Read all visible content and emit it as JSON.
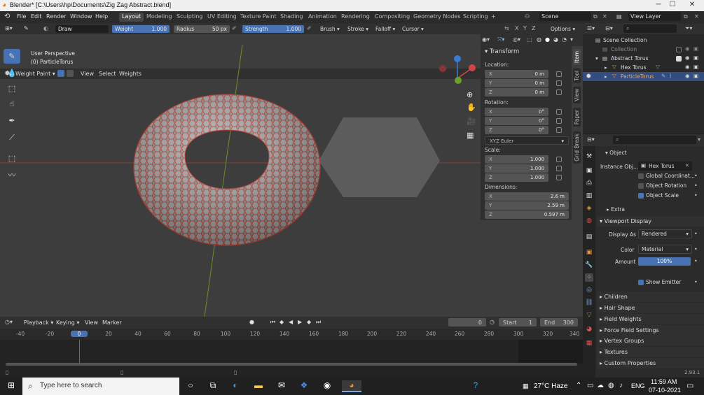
{
  "window": {
    "title": "Blender* [C:\\Users\\hp\\Documents\\Zig Zag Abstract.blend]",
    "minimize": "─",
    "maximize": "☐",
    "close": "✕"
  },
  "menu": [
    "File",
    "Edit",
    "Render",
    "Window",
    "Help"
  ],
  "workspaces": [
    "Layout",
    "Modeling",
    "Sculpting",
    "UV Editing",
    "Texture Paint",
    "Shading",
    "Animation",
    "Rendering",
    "Compositing",
    "Geometry Nodes",
    "Scripting"
  ],
  "active_workspace": "Layout",
  "add_workspace": "+",
  "scene": "Scene",
  "view_layer": "View Layer",
  "toolheader": {
    "brush_name": "Draw",
    "weight_label": "Weight",
    "weight_value": "1.000",
    "radius_label": "Radius",
    "radius_value": "50 px",
    "strength_label": "Strength",
    "strength_value": "1.000",
    "menus": [
      "Brush",
      "Stroke",
      "Falloff",
      "Cursor"
    ],
    "options": "Options",
    "xyz": [
      "X",
      "Y",
      "Z"
    ]
  },
  "viewport_header": {
    "mode": "Weight Paint",
    "menus": [
      "View",
      "Select",
      "Weights"
    ]
  },
  "viewport": {
    "perspective": "User Perspective",
    "object": "(0) ParticleTorus"
  },
  "npanel": {
    "section": "Transform",
    "location_label": "Location:",
    "location": [
      [
        "X",
        "0 m"
      ],
      [
        "Y",
        "0 m"
      ],
      [
        "Z",
        "0 m"
      ]
    ],
    "rotation_label": "Rotation:",
    "rotation": [
      [
        "X",
        "0°"
      ],
      [
        "Y",
        "0°"
      ],
      [
        "Z",
        "0°"
      ]
    ],
    "rotation_mode": "XYZ Euler",
    "scale_label": "Scale:",
    "scale": [
      [
        "X",
        "1.000"
      ],
      [
        "Y",
        "1.000"
      ],
      [
        "Z",
        "1.000"
      ]
    ],
    "dimensions_label": "Dimensions:",
    "dimensions": [
      [
        "X",
        "2.6 m"
      ],
      [
        "Y",
        "2.59 m"
      ],
      [
        "Z",
        "0.597 m"
      ]
    ],
    "tabs": [
      "Item",
      "Tool",
      "View",
      "Paper",
      "Grid Break"
    ]
  },
  "timeline": {
    "menus": [
      "Playback",
      "Keying",
      "View",
      "Marker"
    ],
    "current_frame": "0",
    "start_label": "Start",
    "start": "1",
    "end_label": "End",
    "end": "300",
    "ruler": [
      "-40",
      "-20",
      "0",
      "20",
      "40",
      "60",
      "80",
      "100",
      "120",
      "140",
      "160",
      "180",
      "200",
      "220",
      "240",
      "260",
      "280",
      "300",
      "320",
      "340"
    ]
  },
  "outliner": {
    "rows": [
      "Scene Collection",
      "Collection",
      "Abstract Torus",
      "Hex Torus",
      "ParticleTorus"
    ]
  },
  "properties": {
    "section_object": "Object",
    "instance_label": "Instance Obj...",
    "instance_value": "Hex Torus",
    "checks": [
      [
        "Global Coordinat...",
        false
      ],
      [
        "Object Rotation",
        false
      ],
      [
        "Object Scale",
        true
      ]
    ],
    "extra": "Extra",
    "viewport_display": "Viewport Display",
    "display_as_label": "Display As",
    "display_as": "Rendered",
    "color_label": "Color",
    "color": "Material",
    "amount_label": "Amount",
    "amount": "100%",
    "show_emitter": "Show Emitter",
    "collapsed": [
      "Children",
      "Hair Shape",
      "Field Weights",
      "Force Field Settings",
      "Vertex Groups",
      "Textures",
      "Custom Properties"
    ]
  },
  "version": "2.93.1",
  "taskbar": {
    "search_placeholder": "Type here to search",
    "weather": "27°C Haze",
    "lang": "ENG",
    "time": "11:59 AM",
    "date": "07-10-2021"
  },
  "colors": {
    "accent": "#4772b3",
    "selected_row": "#334d80",
    "torus_wire": "#c0392b"
  }
}
